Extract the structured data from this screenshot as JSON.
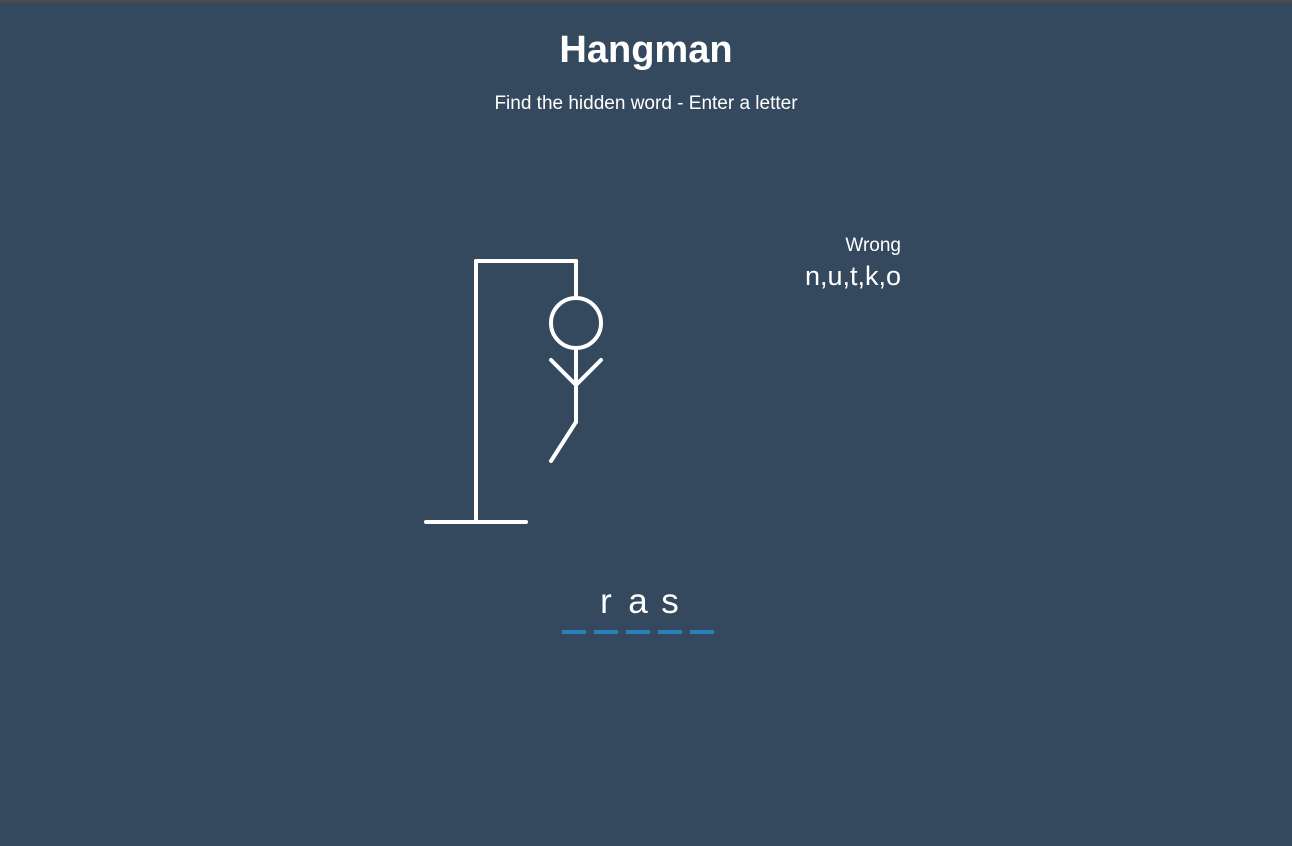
{
  "title": "Hangman",
  "subtitle": "Find the hidden word - Enter a letter",
  "wrong": {
    "label": "Wrong",
    "letters": "n,u,t,k,o"
  },
  "word": {
    "slots": [
      "",
      "r",
      "a",
      "s",
      ""
    ]
  },
  "colors": {
    "background": "#34495e",
    "text": "#ffffff",
    "underline": "#2980b9"
  },
  "figure": {
    "parts_shown": [
      "head",
      "body",
      "left-arm",
      "right-arm",
      "left-leg"
    ]
  }
}
